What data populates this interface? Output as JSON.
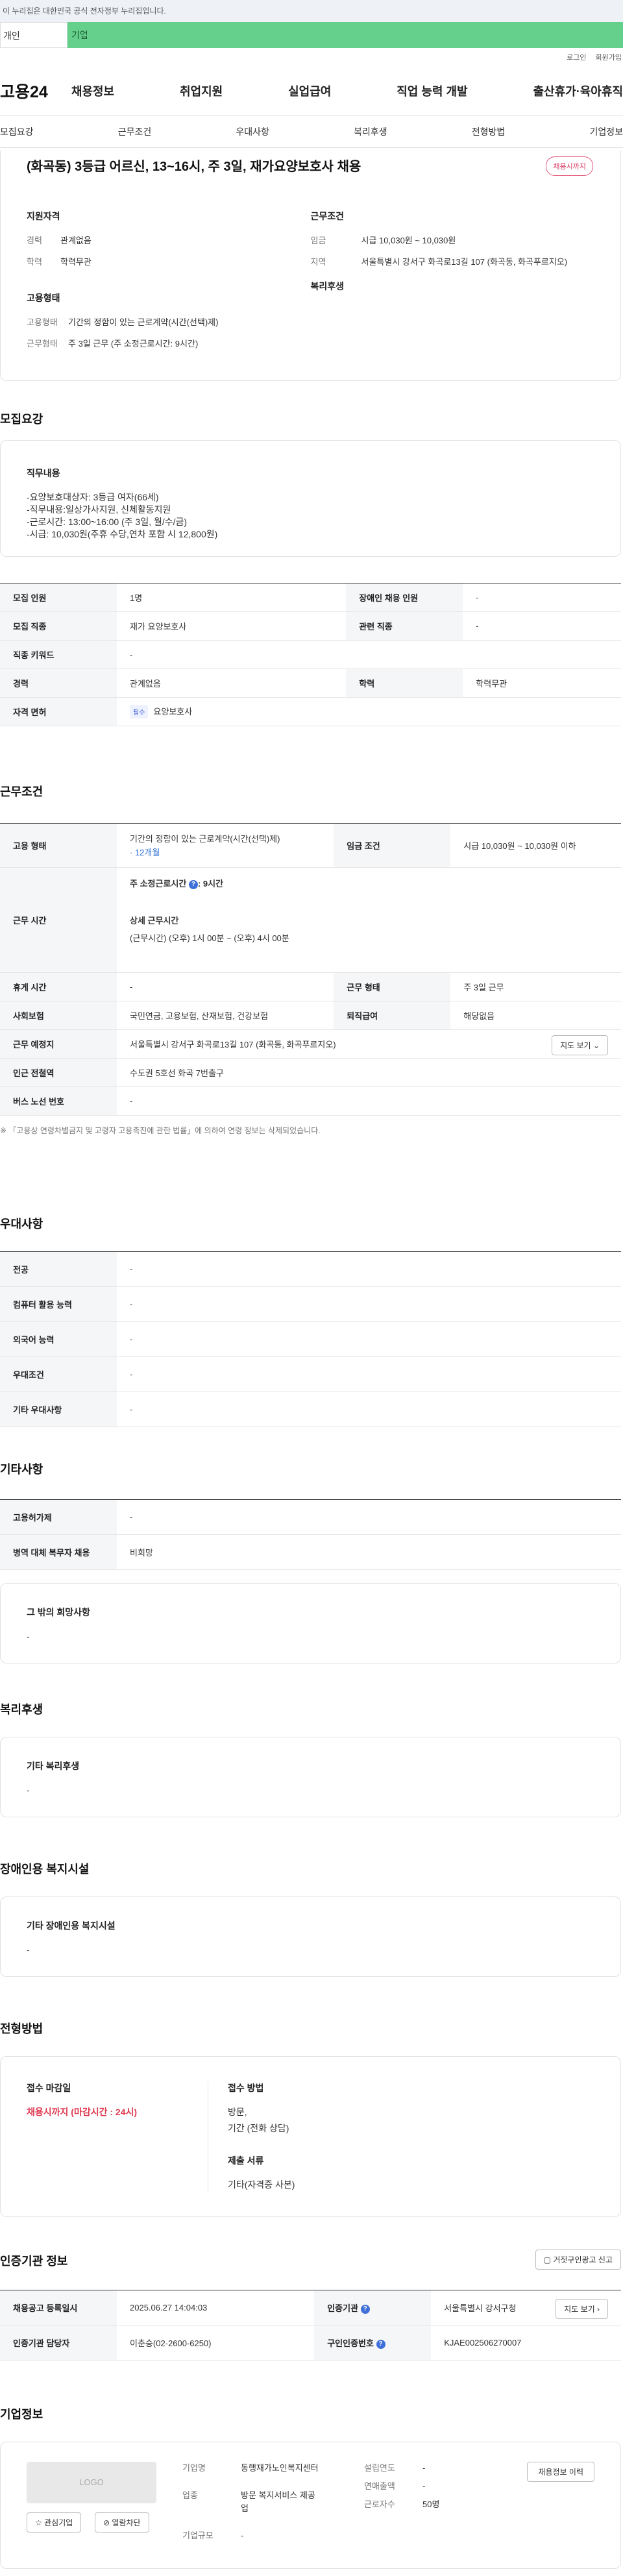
{
  "notice": "이 누리집은 대한민국 공식 전자정부 누리집입니다.",
  "global_tabs": [
    "개인",
    "기업"
  ],
  "util_links": [
    "로그인",
    "회원가입"
  ],
  "logo": "고용24",
  "gnb": [
    "채용정보",
    "취업지원",
    "실업급여",
    "직업 능력 개발",
    "출산휴가·육아휴직"
  ],
  "anchors": [
    "모집요강",
    "근무조건",
    "우대사항",
    "복리후생",
    "전형방법",
    "기업정보"
  ],
  "job": {
    "title": "(화곡동) 3등급 어르신, 13~16시, 주 3일, 재가요양보호사 채용",
    "badge": "채용시까지",
    "summary": {
      "qual_title": "지원자격",
      "career_k": "경력",
      "career_v": "관계없음",
      "edu_k": "학력",
      "edu_v": "학력무관",
      "cond_title": "근무조건",
      "wage_k": "임금",
      "wage_v": "시급 10,030원 ~ 10,030원",
      "region_k": "지역",
      "region_v": "서울특별시 강서구 화곡로13길 107 (화곡동, 화곡푸르지오)",
      "emp_title": "고용형태",
      "emptype_k": "고용형태",
      "emptype_v": "기간의 정함이 있는 근로계약(시간(선택)제)",
      "worktype_k": "근무형태",
      "worktype_v": "주 3일 근무 (주 소정근로시간: 9시간)",
      "welfare_title": "복리후생"
    }
  },
  "recruit": {
    "title": "모집요강",
    "duty_title": "직무내용",
    "duty_lines": [
      "-요양보호대상자: 3등급 여자(66세)",
      "-직무내용:일상가사지원, 신체활동지원",
      "-근로시간: 13:00~16:00 (주 3일, 월/수/금)",
      "-시급: 10,030원(주휴 수당,연차 포함 시 12,800원)"
    ],
    "rows": [
      {
        "k1": "모집 인원",
        "v1": "1명",
        "k2": "장애인 채용 인원",
        "v2": "-"
      },
      {
        "k1": "모집 직종",
        "v1": "재가 요양보호사",
        "k2": "관련 직종",
        "v2": "-"
      },
      {
        "k1": "직종 키워드",
        "v1": "-"
      },
      {
        "k1": "경력",
        "v1": "관계없음",
        "k2": "학력",
        "v2": "학력무관"
      },
      {
        "k1": "자격 면허",
        "chip": "필수",
        "v1": "요양보호사"
      }
    ]
  },
  "work": {
    "title": "근무조건",
    "emp_k": "고용 형태",
    "emp_v": "기간의 정함이 있는 근로계약(시간(선택)제)",
    "emp_period": "· 12개월",
    "wage_k": "임금 조건",
    "wage_v": "시급 10,030원 ~ 10,030원 이하",
    "time_k": "근무 시간",
    "time_weekly": "주 소정근로시간",
    "time_weekly_v": ": 9시간",
    "time_detail_title": "상세 근무시간",
    "time_detail_v": "(근무시간) (오후) 1시 00분 ~ (오후) 4시 00분",
    "rest_k": "휴게 시간",
    "rest_v": "-",
    "form_k": "근무 형태",
    "form_v": "주 3일 근무",
    "ins_k": "사회보험",
    "ins_v": "국민연금, 고용보험, 산재보험, 건강보험",
    "sev_k": "퇴직급여",
    "sev_v": "해당없음",
    "place_k": "근무 예정지",
    "place_v": "서울특별시 강서구 화곡로13길 107 (화곡동, 화곡푸르지오)",
    "map_btn": "지도 보기",
    "subway_k": "인근 전철역",
    "subway_v": "수도권 5호선 화곡 7번출구",
    "bus_k": "버스 노선 번호",
    "bus_v": "-",
    "footnote": "※ 「고용상 연령차별금지 및 고령자 고용촉진에 관한 법률」에 의하여 연령 정보는 삭제되었습니다."
  },
  "pref": {
    "title": "우대사항",
    "rows": [
      {
        "k": "전공",
        "v": "-"
      },
      {
        "k": "컴퓨터 활용 능력",
        "v": "-"
      },
      {
        "k": "외국어 능력",
        "v": "-"
      },
      {
        "k": "우대조건",
        "v": "-"
      },
      {
        "k": "기타 우대사항",
        "v": "-"
      }
    ]
  },
  "etc": {
    "title": "기타사항",
    "rows": [
      {
        "k": "고용허가제",
        "v": "-"
      },
      {
        "k": "병역 대체 복무자 채용",
        "v": "비희망"
      }
    ],
    "box_title": "그 밖의 희망사항",
    "box_v": "-"
  },
  "welfare": {
    "title": "복리후생",
    "box_title": "기타 복리후생",
    "box_v": "-"
  },
  "disabled": {
    "title": "장애인용 복지시설",
    "box_title": "기타 장애인용 복지시설",
    "box_v": "-"
  },
  "selection": {
    "title": "전형방법",
    "deadline_t": "접수 마감일",
    "deadline_v": "채용시까지 (마감시간 : 24시)",
    "method_t": "접수 방법",
    "method_v1": "방문,",
    "method_v2": "기간 (전화 상담)",
    "docs_t": "제출 서류",
    "docs_v": "기타(자격증 사본)"
  },
  "agency": {
    "title": "인증기관 정보",
    "report_btn": "거짓구인광고 신고",
    "date_k": "채용공고 등록일시",
    "date_v": "2025.06.27 14:04:03",
    "org_k": "인증기관",
    "org_v": "서울특별시 강서구청",
    "map_btn": "지도 보기",
    "mgr_k": "인증기관 담당자",
    "mgr_v": "이춘승(02-2600-6250)",
    "num_k": "구인인증번호",
    "num_v": "KJAE002506270007"
  },
  "company": {
    "title": "기업정보",
    "logo_text": "LOGO",
    "fav_btn": "관심기업",
    "block_btn": "열람차단",
    "name_k": "기업명",
    "name_v": "동행재가노인복지센터",
    "ind_k": "업종",
    "ind_v": "방문 복지서비스 제공업",
    "scale_k": "기업규모",
    "scale_v": "-",
    "year_k": "설립연도",
    "year_v": "-",
    "sales_k": "연매출액",
    "sales_v": "-",
    "emp_k": "근로자수",
    "emp_v": "50명",
    "history_btn": "채용정보 이력"
  }
}
